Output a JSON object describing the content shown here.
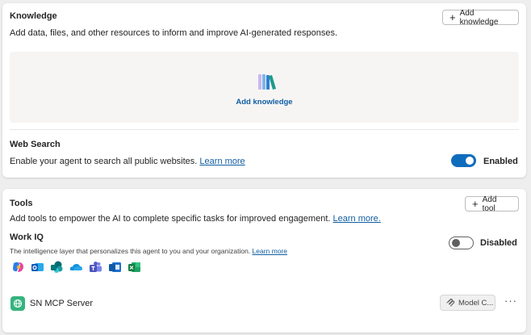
{
  "knowledge": {
    "title": "Knowledge",
    "add_button_label": "Add knowledge",
    "description": "Add data, files, and other resources to inform and improve AI-generated responses.",
    "dropzone_label": "Add knowledge"
  },
  "web_search": {
    "title": "Web Search",
    "description": "Enable your agent to search all public websites.",
    "learn_more": "Learn more",
    "toggle_state": "on",
    "toggle_label": "Enabled"
  },
  "tools": {
    "title": "Tools",
    "add_button_label": "Add tool",
    "description": "Add tools to empower the AI to complete specific tasks for improved engagement.",
    "learn_more": "Learn more.",
    "work_iq": {
      "title": "Work IQ",
      "description": "The intelligence layer that personalizes this agent to you and your organization.",
      "learn_more": "Learn more",
      "toggle_state": "off",
      "toggle_label": "Disabled",
      "app_icons": [
        "copilot-icon",
        "outlook-icon",
        "sharepoint-icon",
        "onedrive-icon",
        "teams-icon",
        "outlook-calendar-icon",
        "excel-icon"
      ]
    },
    "items": [
      {
        "name": "SN MCP Server",
        "icon": "globe-icon",
        "tag_label": "Model C...",
        "tag_icon": "mcp-icon",
        "more_label": "···"
      }
    ]
  },
  "colors": {
    "accent": "#0f6cbd",
    "link": "#115ea3",
    "card_bg": "#ffffff",
    "page_bg": "#eeeeee",
    "dropzone_bg": "#f6f5f4",
    "mcp_icon_bg": "#36b37e"
  }
}
